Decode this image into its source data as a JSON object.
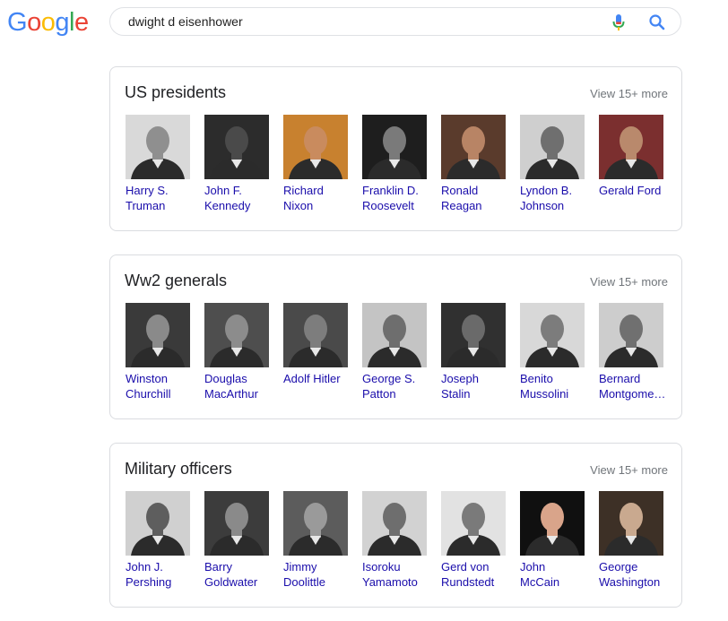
{
  "logo": {
    "letters": [
      {
        "char": "G",
        "color": "#4285f4"
      },
      {
        "char": "o",
        "color": "#ea4335"
      },
      {
        "char": "o",
        "color": "#fbbc05"
      },
      {
        "char": "g",
        "color": "#4285f4"
      },
      {
        "char": "l",
        "color": "#34a853"
      },
      {
        "char": "e",
        "color": "#ea4335"
      }
    ]
  },
  "search": {
    "query": "dwight d eisenhower",
    "mic_icon": "microphone-icon",
    "search_icon": "search-icon"
  },
  "cards": [
    {
      "title": "US presidents",
      "more": "View 15+ more",
      "items": [
        {
          "line1": "Harry S.",
          "line2": "Truman",
          "tone": "#8f8f8f",
          "bg": "#d9d9d9"
        },
        {
          "line1": "John F.",
          "line2": "Kennedy",
          "tone": "#4a4a4a",
          "bg": "#2c2c2c"
        },
        {
          "line1": "Richard",
          "line2": "Nixon",
          "tone": "#c98b5e",
          "bg": "#c8812f"
        },
        {
          "line1": "Franklin D.",
          "line2": "Roosevelt",
          "tone": "#7a7a7a",
          "bg": "#1e1e1e"
        },
        {
          "line1": "Ronald",
          "line2": "Reagan",
          "tone": "#b88465",
          "bg": "#5a3b2c"
        },
        {
          "line1": "Lyndon B.",
          "line2": "Johnson",
          "tone": "#6f6f6f",
          "bg": "#cfcfcf"
        },
        {
          "line1": "Gerald Ford",
          "line2": "",
          "tone": "#b9896c",
          "bg": "#7b2f2f"
        }
      ]
    },
    {
      "title": "Ww2 generals",
      "more": "View 15+ more",
      "items": [
        {
          "line1": "Winston",
          "line2": "Churchill",
          "tone": "#8a8a8a",
          "bg": "#3a3a3a"
        },
        {
          "line1": "Douglas",
          "line2": "MacArthur",
          "tone": "#8c8c8c",
          "bg": "#4e4e4e"
        },
        {
          "line1": "Adolf Hitler",
          "line2": "",
          "tone": "#7d7d7d",
          "bg": "#4a4a4a"
        },
        {
          "line1": "George S.",
          "line2": "Patton",
          "tone": "#6e6e6e",
          "bg": "#c4c4c4"
        },
        {
          "line1": "Joseph",
          "line2": "Stalin",
          "tone": "#6a6a6a",
          "bg": "#303030"
        },
        {
          "line1": "Benito",
          "line2": "Mussolini",
          "tone": "#7c7c7c",
          "bg": "#d8d8d8"
        },
        {
          "line1": "Bernard",
          "line2": "Montgome…",
          "tone": "#707070",
          "bg": "#cdcdcd"
        }
      ]
    },
    {
      "title": "Military officers",
      "more": "View 15+ more",
      "items": [
        {
          "line1": "John J.",
          "line2": "Pershing",
          "tone": "#5e5e5e",
          "bg": "#d0d0d0"
        },
        {
          "line1": "Barry",
          "line2": "Goldwater",
          "tone": "#8a8a8a",
          "bg": "#3c3c3c"
        },
        {
          "line1": "Jimmy",
          "line2": "Doolittle",
          "tone": "#9a9a9a",
          "bg": "#5c5c5c"
        },
        {
          "line1": "Isoroku",
          "line2": "Yamamoto",
          "tone": "#6e6e6e",
          "bg": "#d2d2d2"
        },
        {
          "line1": "Gerd von",
          "line2": "Rundstedt",
          "tone": "#7a7a7a",
          "bg": "#e2e2e2"
        },
        {
          "line1": "John",
          "line2": "McCain",
          "tone": "#d9a48a",
          "bg": "#101010"
        },
        {
          "line1": "George",
          "line2": "Washington",
          "tone": "#c9a98f",
          "bg": "#3d3026"
        }
      ]
    }
  ]
}
